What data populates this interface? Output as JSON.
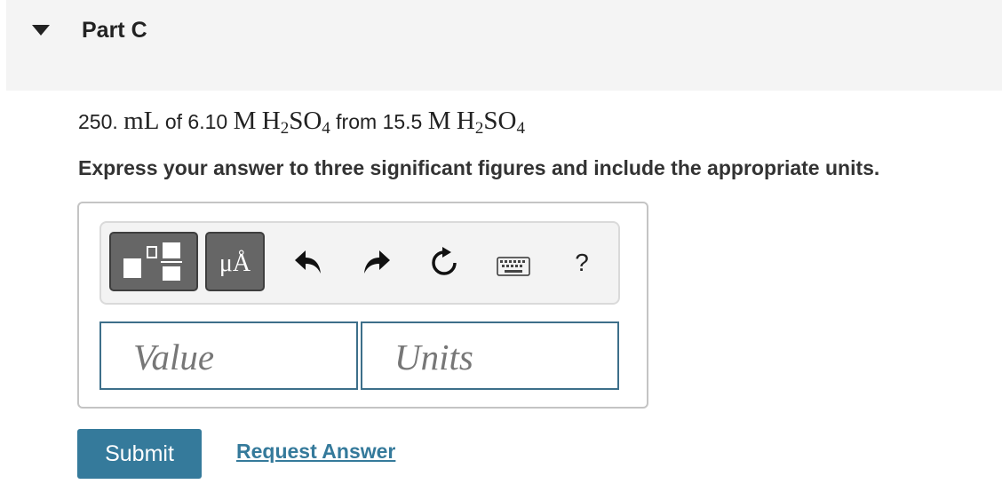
{
  "part": {
    "title": "Part C"
  },
  "question": {
    "volume_num": "250.",
    "volume_unit": "mL",
    "of": "of",
    "conc1": "6.10",
    "molar": "M",
    "formula_h": "H",
    "formula_so": "SO",
    "sub_2": "2",
    "sub_4": "4",
    "from": "from",
    "conc2": "15.5"
  },
  "instruction": "Express your answer to three significant figures and include the appropriate units.",
  "toolbar": {
    "units_label": "μÅ",
    "help_label": "?",
    "icons": [
      "templates-icon",
      "units-icon",
      "undo-icon",
      "redo-icon",
      "reset-icon",
      "keyboard-icon",
      "help-icon"
    ]
  },
  "answer": {
    "value_placeholder": "Value",
    "units_placeholder": "Units"
  },
  "actions": {
    "submit_label": "Submit",
    "request_label": "Request Answer"
  },
  "colors": {
    "accent": "#357a9b",
    "field_border": "#3d6f8a",
    "header_bg": "#f4f4f4"
  }
}
